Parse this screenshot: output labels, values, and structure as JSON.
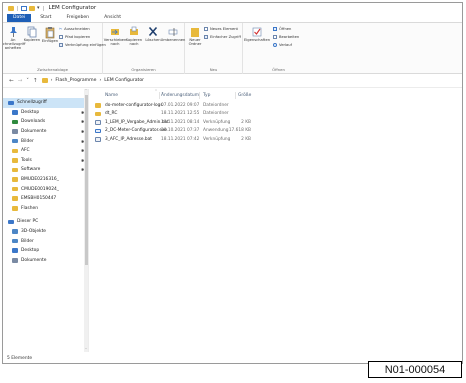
{
  "window": {
    "title": "LEM Configurator"
  },
  "tabs": [
    "Datei",
    "Start",
    "Freigeben",
    "Ansicht"
  ],
  "ribbon": {
    "clipboard": {
      "pin_label": "An Schnellzugriff anheften",
      "copy_label": "Kopieren",
      "paste_label": "Einfügen",
      "cut_label": "Ausschneiden",
      "copy_path_label": "Pfad kopieren",
      "paste_shortcut_label": "Verknüpfung einfügen",
      "group_label": "Zwischenablage"
    },
    "organize": {
      "move_label": "Verschieben nach",
      "copy_to_label": "Kopieren nach",
      "delete_label": "Löschen",
      "rename_label": "Umbenennen",
      "group_label": "Organisieren"
    },
    "new": {
      "new_folder_label": "Neuer Ordner",
      "new_item_label": "Neues Element",
      "easy_access_label": "Einfacher Zugriff",
      "group_label": "Neu"
    },
    "open": {
      "properties_label": "Eigenschaften",
      "open_label": "Öffnen",
      "edit_label": "Bearbeiten",
      "history_label": "Verlauf",
      "group_label": "Öffnen"
    }
  },
  "address": {
    "back": "←",
    "forward": "→",
    "dropdown": "˅",
    "up": "↑",
    "crumbs": [
      "Flash_Programme",
      "LEM Configurator"
    ],
    "separator": "›"
  },
  "nav": {
    "items": [
      {
        "label": "Schnellzugriff",
        "icon": "star-icon",
        "color": "#3b77c9",
        "indent": 0,
        "pinned": false,
        "selected": true
      },
      {
        "label": "Desktop",
        "icon": "desktop-icon",
        "color": "#3b77c9",
        "indent": 1,
        "pinned": true
      },
      {
        "label": "Downloads",
        "icon": "download-icon",
        "color": "#2f8a3f",
        "indent": 1,
        "pinned": true
      },
      {
        "label": "Dokumente",
        "icon": "document-icon",
        "color": "#7a8aa3",
        "indent": 1,
        "pinned": true
      },
      {
        "label": "Bilder",
        "icon": "pictures-icon",
        "color": "#4c86c6",
        "indent": 1,
        "pinned": true
      },
      {
        "label": "AFC",
        "icon": "folder-icon",
        "color": "#e8b93c",
        "indent": 1,
        "pinned": true
      },
      {
        "label": "Tools",
        "icon": "folder-icon",
        "color": "#e8b93c",
        "indent": 1,
        "pinned": true
      },
      {
        "label": "Software",
        "icon": "folder-icon",
        "color": "#e8b93c",
        "indent": 1,
        "pinned": true
      },
      {
        "label": "BMUDE0216316_",
        "icon": "folder-icon",
        "color": "#e8b93c",
        "indent": 1,
        "pinned": false
      },
      {
        "label": "CMUDE0019024_",
        "icon": "folder-icon",
        "color": "#e8b93c",
        "indent": 1,
        "pinned": false
      },
      {
        "label": "EMSBH0150447",
        "icon": "folder-icon",
        "color": "#e8b93c",
        "indent": 1,
        "pinned": false
      },
      {
        "label": "Flashen",
        "icon": "folder-icon",
        "color": "#e8b93c",
        "indent": 1,
        "pinned": false
      },
      {
        "label": "Dieser PC",
        "icon": "computer-icon",
        "color": "#3b77c9",
        "indent": 0,
        "pinned": false
      },
      {
        "label": "3D-Objekte",
        "icon": "cube-icon",
        "color": "#4c86c6",
        "indent": 1,
        "pinned": false
      },
      {
        "label": "Bilder",
        "icon": "pictures-icon",
        "color": "#4c86c6",
        "indent": 1,
        "pinned": false
      },
      {
        "label": "Desktop",
        "icon": "desktop-icon",
        "color": "#3b77c9",
        "indent": 1,
        "pinned": false
      },
      {
        "label": "Dokumente",
        "icon": "document-icon",
        "color": "#7a8aa3",
        "indent": 1,
        "pinned": false
      }
    ],
    "pin_glyph": "✱"
  },
  "files": {
    "columns": [
      "Name",
      "Änderungsdatum",
      "Typ",
      "Größe"
    ],
    "rows": [
      {
        "name": "do-meter-configurator-logs",
        "date": "07.01.2022 09:07",
        "type": "Dateiordner",
        "size": "",
        "icon": "folder-icon",
        "kind": "folder"
      },
      {
        "name": "dt_RC",
        "date": "18.11.2021 12:55",
        "type": "Dateiordner",
        "size": "",
        "icon": "folder-icon",
        "kind": "folder"
      },
      {
        "name": "1_LEM_IP_Vergabe_Admin.bat",
        "date": "18.11.2021 08:14",
        "type": "Verknüpfung",
        "size": "2 KB",
        "icon": "batch-file-icon",
        "kind": "bat"
      },
      {
        "name": "2_DC-Meter-Configurator.exe",
        "date": "20.10.2021 07:37",
        "type": "Anwendung",
        "size": "17.618 KB",
        "icon": "exe-file-icon",
        "kind": "exe"
      },
      {
        "name": "3_AFC_IP_Adresse.bat",
        "date": "18.11.2021 07:42",
        "type": "Verknüpfung",
        "size": "2 KB",
        "icon": "batch-file-icon",
        "kind": "bat"
      }
    ]
  },
  "status": {
    "count_text": "5 Elemente"
  },
  "figure_code": "N01-000054"
}
